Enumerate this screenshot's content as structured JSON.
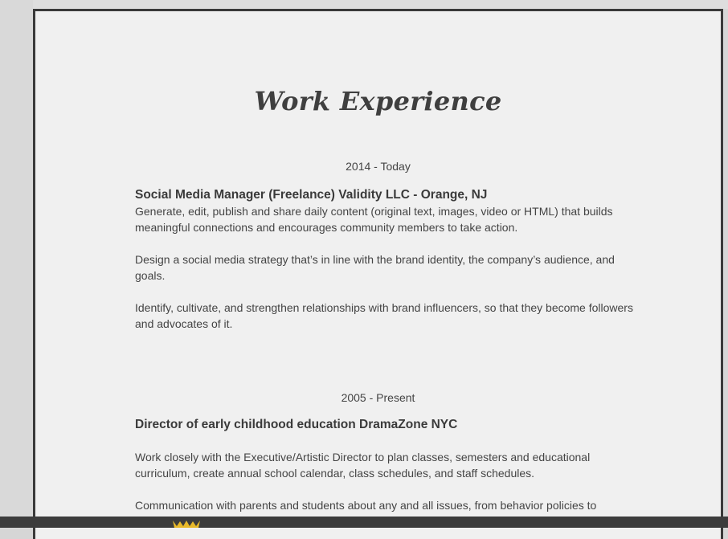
{
  "section_title": "Work Experience",
  "jobs": [
    {
      "date": "2014 - Today",
      "title": "Social Media Manager (Freelance) Validity LLC - Orange, NJ",
      "paragraphs": [
        "Generate, edit, publish and share daily content (original text, images, video or HTML) that builds meaningful connections and encourages community members to take action.",
        "Design a social media strategy that’s in line with the brand identity, the company’s audience, and goals.",
        "Identify, cultivate, and strengthen relationships with brand influencers, so that they become followers and advocates of it."
      ]
    },
    {
      "date": "2005 - Present",
      "title": "Director of early childhood education DramaZone NYC",
      "paragraphs": [
        "Work closely with the Executive/Artistic Director to plan classes, semesters and educational curriculum, create annual school calendar, class schedules, and staff schedules.",
        "Communication with parents and students about any and all issues, from behavior policies to"
      ]
    }
  ],
  "colors": {
    "page_bg": "#f0f0f0",
    "frame": "#3a3a3a",
    "text": "#444444",
    "logo": "#e8b92a"
  },
  "icons": {
    "logo": "crown-logo-icon"
  }
}
